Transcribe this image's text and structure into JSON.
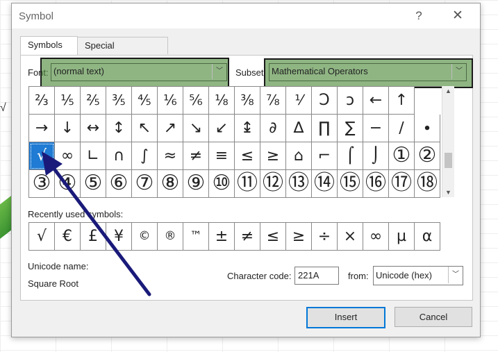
{
  "background": {
    "cell_text": "√"
  },
  "dialog": {
    "title": "Symbol",
    "help_icon": "?",
    "close_icon": "✕"
  },
  "tabs": [
    {
      "label": "Symbols",
      "active": true
    },
    {
      "label": "Special Characters",
      "active": false
    }
  ],
  "font": {
    "label": "Font:",
    "value": "(normal text)"
  },
  "subset": {
    "label": "Subset:",
    "value": "Mathematical Operators"
  },
  "highlight_color": "#4b8737",
  "grid": {
    "rows": [
      [
        "⅔",
        "⅕",
        "⅖",
        "⅗",
        "⅘",
        "⅙",
        "⅚",
        "⅛",
        "⅜",
        "⅞",
        "⅟",
        "Ↄ",
        "ↄ",
        "←",
        "↑"
      ],
      [
        "→",
        "↓",
        "↔",
        "↕",
        "↖",
        "↗",
        "↘",
        "↙",
        "↨",
        "∂",
        "∆",
        "∏",
        "∑",
        "−",
        "∕",
        "∙"
      ],
      [
        "√",
        "∞",
        "∟",
        "∩",
        "∫",
        "≈",
        "≠",
        "≡",
        "≤",
        "≥",
        "⌂",
        "⌐",
        "⌠",
        "⌡",
        "①",
        "②"
      ],
      [
        "③",
        "④",
        "⑤",
        "⑥",
        "⑦",
        "⑧",
        "⑨",
        "⑩",
        "⑪",
        "⑫",
        "⑬",
        "⑭",
        "⑮",
        "⑯",
        "⑰",
        "⑱"
      ]
    ],
    "selected": "√"
  },
  "recent": {
    "label": "Recently used symbols:",
    "symbols": [
      "√",
      "€",
      "£",
      "¥",
      "©",
      "®",
      "™",
      "±",
      "≠",
      "≤",
      "≥",
      "÷",
      "×",
      "∞",
      "µ",
      "α"
    ]
  },
  "unicode_name": {
    "label": "Unicode name:",
    "value": "Square Root"
  },
  "character_code": {
    "label": "Character code:",
    "value": "221A"
  },
  "from": {
    "label": "from:",
    "value": "Unicode (hex)"
  },
  "buttons": {
    "insert": "Insert",
    "cancel": "Cancel"
  },
  "annotation_arrow_color": "#1a1a7a",
  "selected_color": "#1f7bd3"
}
